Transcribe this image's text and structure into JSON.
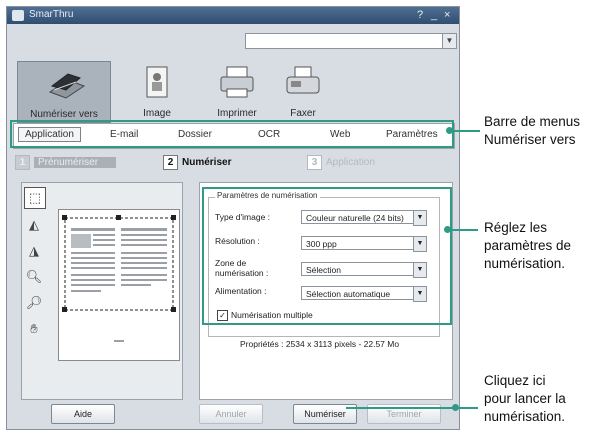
{
  "window": {
    "title": "SmarThru"
  },
  "top_buttons": [
    {
      "label": "Numériser vers",
      "icon": "scanner-icon",
      "selected": true
    },
    {
      "label": "Image",
      "icon": "image-icon",
      "selected": false
    },
    {
      "label": "Imprimer",
      "icon": "printer-icon",
      "selected": false
    },
    {
      "label": "Faxer",
      "icon": "fax-icon",
      "selected": false
    }
  ],
  "menu": [
    "Application",
    "E-mail",
    "Dossier",
    "OCR",
    "Web",
    "Paramètres"
  ],
  "wizard": {
    "step1": {
      "num": "1",
      "label": "Prénumériser"
    },
    "step2": {
      "num": "2",
      "label": "Numériser"
    },
    "step3": {
      "num": "3",
      "label": "Application"
    }
  },
  "settings": {
    "legend": "Paramètres de numérisation",
    "type_label": "Type d'image :",
    "type_value": "Couleur naturelle (24 bits)",
    "resolution_label": "Résolution :",
    "resolution_value": "300 ppp",
    "zone_label_1": "Zone de",
    "zone_label_2": "numérisation :",
    "zone_value": "Sélection",
    "feed_label": "Alimentation :",
    "feed_value": "Sélection automatique",
    "multi_label": "Numérisation multiple",
    "multi_checked": "✓",
    "properties": "Propriétés : 2534 x 3113 pixels - 22.57 Mo"
  },
  "buttons": {
    "aide": "Aide",
    "annuler": "Annuler",
    "numeriser": "Numériser",
    "terminer": "Terminer"
  },
  "annotations": {
    "menubar_1": "Barre de menus",
    "menubar_2": "Numériser vers",
    "params_1": "Réglez les",
    "params_2": "paramètres de",
    "params_3": "numérisation.",
    "scan_1": "Cliquez ici",
    "scan_2": "pour lancer la",
    "scan_3": "numérisation."
  },
  "colors": {
    "callout": "#2f9a86",
    "titlebar": "#3b5a80"
  }
}
